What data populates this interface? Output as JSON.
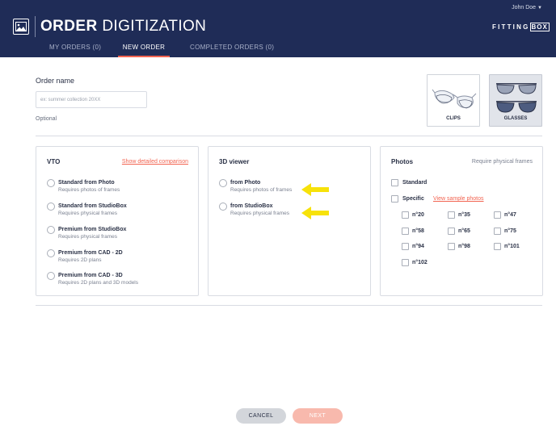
{
  "header": {
    "title_bold": "ORDER",
    "title_light": "DIGITIZATION",
    "user_name": "John Doe",
    "brand_left": "FITTING",
    "brand_right": "BOX",
    "bg_color": "#1f2c57",
    "accent_color": "#f26451"
  },
  "tabs": [
    {
      "label": "MY ORDERS (0)",
      "active": false
    },
    {
      "label": "NEW ORDER",
      "active": true
    },
    {
      "label": "COMPLETED ORDERS (0)",
      "active": false
    }
  ],
  "order": {
    "heading": "Order name",
    "placeholder": "ex: summer collection 20XX",
    "hint": "Optional"
  },
  "types": [
    {
      "label": "CLIPS",
      "icon": "clips-glasses-icon",
      "selected": false
    },
    {
      "label": "GLASSES",
      "icon": "glasses-icon",
      "selected": true
    }
  ],
  "vto": {
    "title": "VTO",
    "link": "Show detailed comparison",
    "options": [
      {
        "label": "Standard from Photo",
        "sub": "Requires photos of frames"
      },
      {
        "label": "Standard from StudioBox",
        "sub": "Requires physical frames"
      },
      {
        "label": "Premium from StudioBox",
        "sub": "Requires physical frames"
      },
      {
        "label": "Premium from CAD - 2D",
        "sub": "Requires 2D plans"
      },
      {
        "label": "Premium from CAD - 3D",
        "sub": "Requires 2D plans and 3D models"
      }
    ]
  },
  "viewer": {
    "title": "3D viewer",
    "options": [
      {
        "label": "from Photo",
        "sub": "Requires photos of frames"
      },
      {
        "label": "from StudioBox",
        "sub": "Requires physical frames"
      }
    ],
    "arrow_color": "#f7e20a"
  },
  "photos": {
    "title": "Photos",
    "note": "Require physical frames",
    "standard_label": "Standard",
    "specific_label": "Specific",
    "specific_link": "View sample photos",
    "angles": [
      "n°20",
      "n°35",
      "n°47",
      "n°58",
      "n°65",
      "n°75",
      "n°94",
      "n°98",
      "n°101",
      "n°102"
    ]
  },
  "actions": {
    "cancel": "CANCEL",
    "next": "NEXT"
  }
}
